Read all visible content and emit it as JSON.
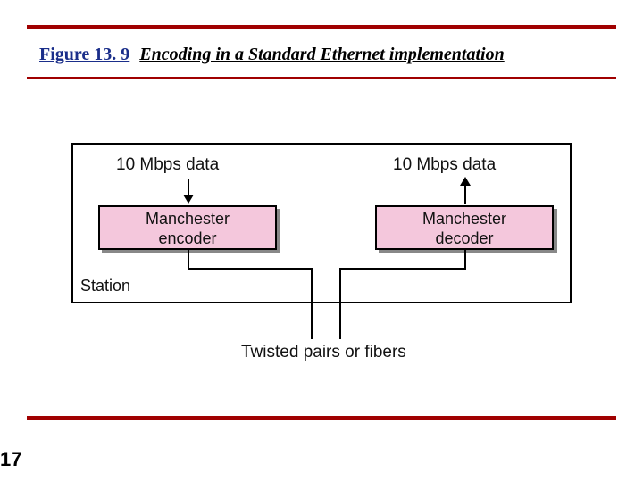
{
  "figure": {
    "number": "Figure 13. 9",
    "caption": "Encoding in a Standard Ethernet implementation"
  },
  "diagram": {
    "data_left": "10 Mbps data",
    "data_right": "10 Mbps data",
    "encoder_l1": "Manchester",
    "encoder_l2": "encoder",
    "decoder_l1": "Manchester",
    "decoder_l2": "decoder",
    "station": "Station",
    "medium": "Twisted pairs or fibers"
  },
  "page_number": "17"
}
